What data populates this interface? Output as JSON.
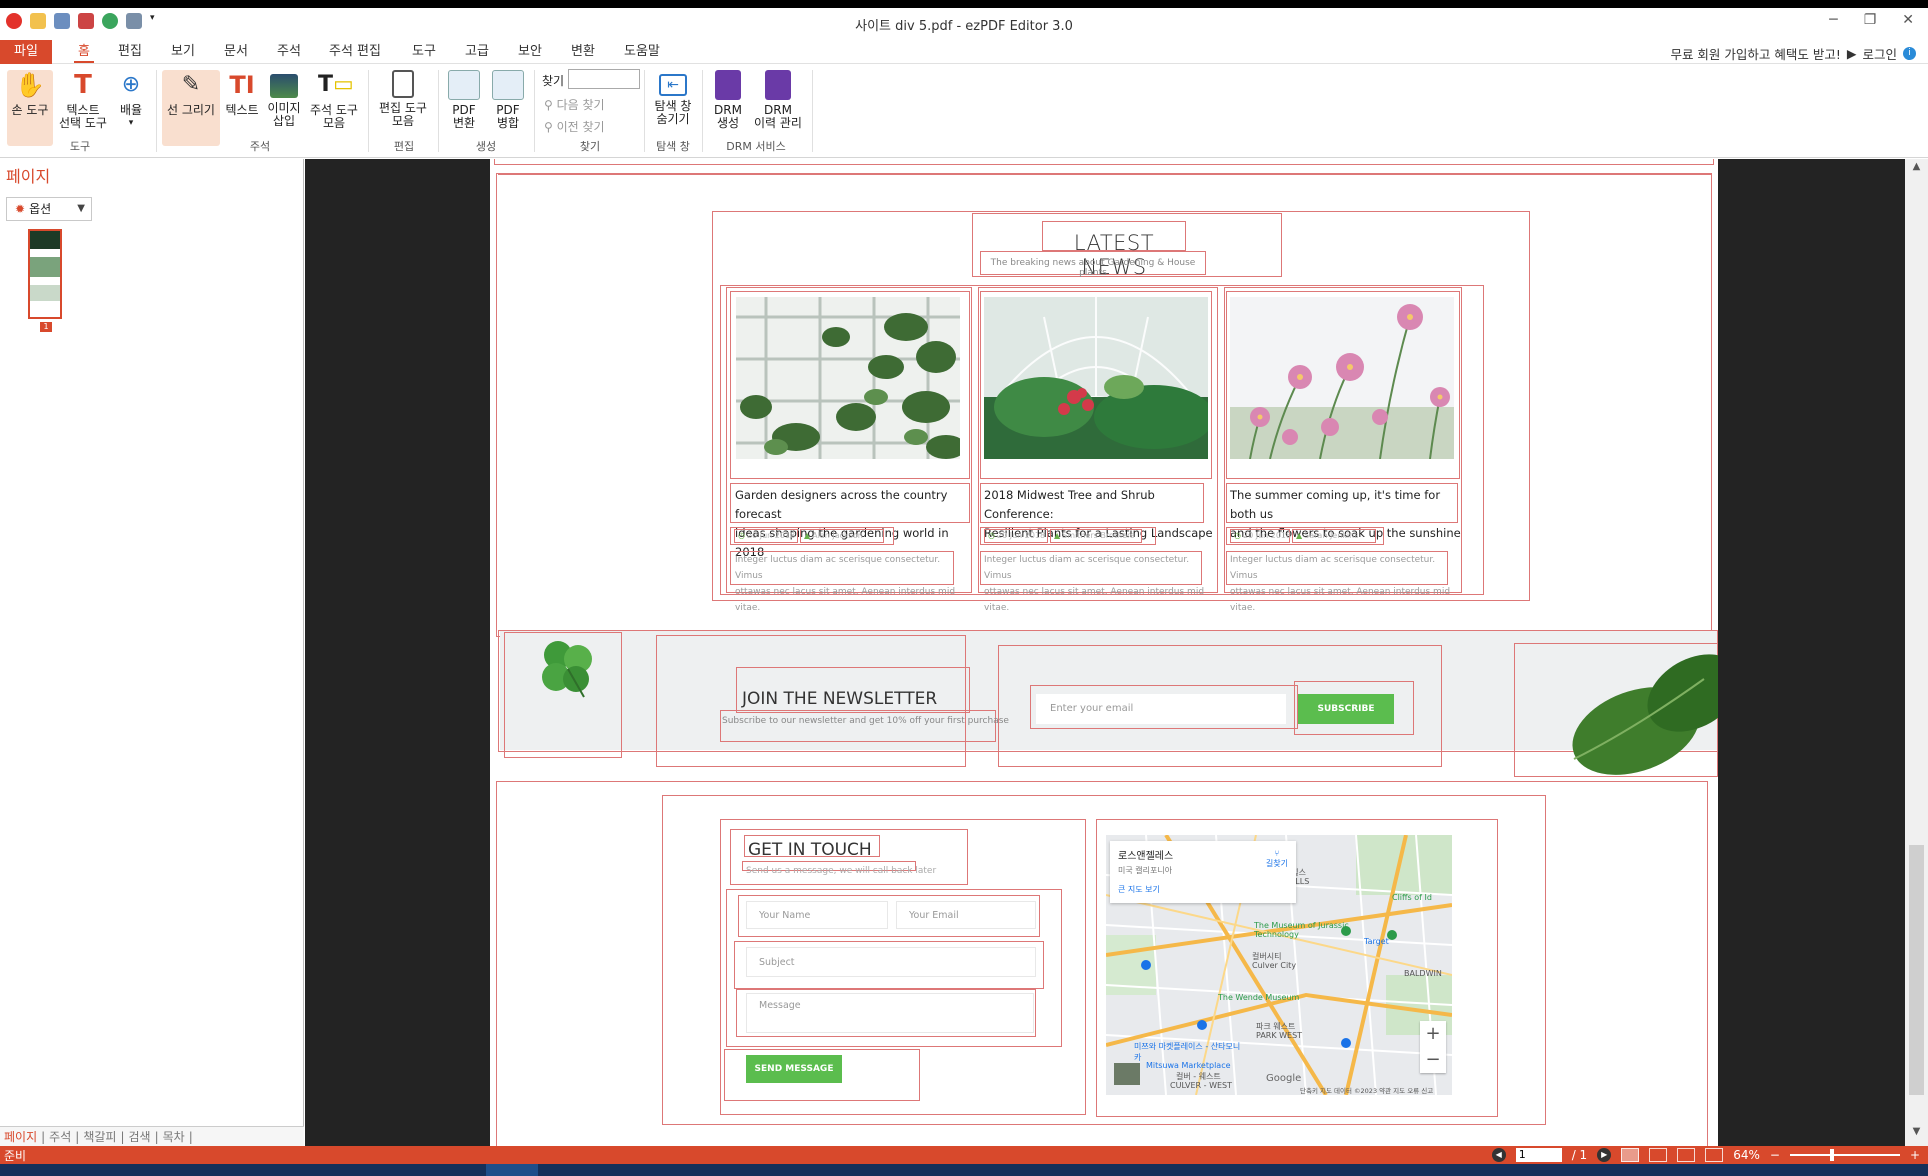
{
  "window": {
    "title": "사이트 div 5.pdf - ezPDF Editor 3.0",
    "controls": [
      "─",
      "❐",
      "✕"
    ]
  },
  "menu": {
    "file": "파일",
    "tabs": [
      "홈",
      "편집",
      "보기",
      "문서",
      "주석",
      "주석 편집",
      "도구",
      "고급",
      "보안",
      "변환",
      "도움말"
    ],
    "active_tab": "홈",
    "promo": "무료 회원 가입하고 혜택도 받고!",
    "login": "로그인"
  },
  "ribbon": {
    "hand_tool": "손 도구",
    "text_select_1": "텍스트",
    "text_select_2": "선택 도구",
    "zoom": "배율",
    "group_tools": "도구",
    "draw_line": "선 그리기",
    "text": "텍스트",
    "image_1": "이미지",
    "image_2": "삽입",
    "annot_tools_1": "주석 도구",
    "annot_tools_2": "모음",
    "group_annot": "주석",
    "edit_tools_1": "편집 도구",
    "edit_tools_2": "모음",
    "group_edit": "편집",
    "pdf_convert_1": "PDF",
    "pdf_convert_2": "변환",
    "pdf_merge_1": "PDF",
    "pdf_merge_2": "병합",
    "group_create": "생성",
    "find_label": "찾기",
    "find_next": "다음 찾기",
    "find_prev": "이전 찾기",
    "group_find": "찾기",
    "nav_hide_1": "탐색 창",
    "nav_hide_2": "숨기기",
    "group_nav": "탐색 창",
    "drm_create_1": "DRM",
    "drm_create_2": "생성",
    "drm_history_1": "DRM",
    "drm_history_2": "이력 관리",
    "group_drm": "DRM 서비스"
  },
  "left_panel": {
    "title": "페이지",
    "options": "옵션",
    "thumb_page": "1",
    "tabs": [
      "페이지",
      "주석",
      "책갈피",
      "검색",
      "목차"
    ]
  },
  "document": {
    "news": {
      "title": "LATEST NEWS",
      "subtitle": "The breaking news about Gardening & House plants",
      "cards": [
        {
          "title_1": "Garden designers across the country forecast",
          "title_2": "ideas shaping the gardening world in 2018",
          "date": "20 Jun 2018",
          "author": "Alan Jackson",
          "excerpt_1": "Integer luctus diam ac scerisque consectetur. Vimus",
          "excerpt_2": "ottawas nec lacus sit amet. Aenean interdus mid vitae."
        },
        {
          "title_1": "2018 Midwest Tree and Shrub Conference:",
          "title_2": "Resilient Plants for a Lasting Landscape",
          "date": "20 Jun 2018",
          "author": "Smithers Brothers",
          "excerpt_1": "Integer luctus diam ac scerisque consectetur. Vimus",
          "excerpt_2": "ottawas nec lacus sit amet. Aenean interdus mid vitae."
        },
        {
          "title_1": "The summer coming up, it's time for both us",
          "title_2": "and the flowers to soak up the sunshine",
          "date": "20 Jun 2018",
          "author": "Sarah Jenkins",
          "excerpt_1": "Integer luctus diam ac scerisque consectetur. Vimus",
          "excerpt_2": "ottawas nec lacus sit amet. Aenean interdus mid vitae."
        }
      ]
    },
    "newsletter": {
      "title": "JOIN THE NEWSLETTER",
      "subtitle": "Subscribe to our newsletter and get 10% off your first purchase",
      "email_placeholder": "Enter your email",
      "subscribe": "SUBSCRIBE"
    },
    "contact": {
      "title": "GET IN TOUCH",
      "subtitle": "Send us a message, we will call back later",
      "name_placeholder": "Your Name",
      "email_placeholder": "Your Email",
      "subject_placeholder": "Subject",
      "message_placeholder": "Message",
      "send": "SEND MESSAGE"
    },
    "map": {
      "place": "로스앤젤레스",
      "region": "미국 캘리포니아",
      "directions": "길찾기",
      "bigger_map": "큰 지도 보기",
      "labels": [
        "비엔 힐스",
        "PIOT HILLS",
        "The Museum of Jurassic Technology",
        "컬버시티",
        "Culver City",
        "The Wende Museum",
        "파크 웨스트",
        "PARK WEST",
        "미쯔와 마켓플레이스 - 산타모니카",
        "Mitsuwa Marketplace",
        "컬버 - 웨스트",
        "CULVER - WEST",
        "Target",
        "Cliffs of Id",
        "BALDWIN"
      ],
      "google": "Google",
      "footer": "단축키  지도 데이터 ©2023  약관  지도 오류 신고"
    }
  },
  "status": {
    "ready": "준비",
    "page_input": "1",
    "page_total": "/ 1",
    "zoom": "64%"
  },
  "colors": {
    "accent": "#d8492c",
    "green_button": "#5bbd4e",
    "doc_background": "#232323"
  }
}
